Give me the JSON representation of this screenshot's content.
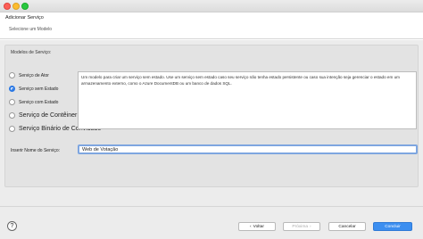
{
  "window": {
    "title": "Adicionar Serviço",
    "subtitle": "Selecione um Modelo"
  },
  "models": {
    "label": "Modelos de Serviço:",
    "options": [
      {
        "label": "Serviço de Ator",
        "selected": false
      },
      {
        "label": "Serviço sem Estado",
        "selected": true
      },
      {
        "label": "Serviço com Estado",
        "selected": false
      },
      {
        "label": "Serviço de Contêiner",
        "selected": false
      },
      {
        "label": "Serviço Binário de Convidado",
        "selected": false
      }
    ],
    "description": "Um modelo para criar um serviço sem estado. Use um serviço sem estado caso seu serviço não tenha estado persistente ou caso sua intenção seja gerenciar o estado em um armazenamento externo, como o Azure DocumentDB ou um banco de dados SQL."
  },
  "service_name": {
    "label": "Inserir Nome do Serviço:",
    "value": "Web de Votação"
  },
  "footer": {
    "help": "?",
    "back": "Voltar",
    "next": "Próxima",
    "cancel": "Cancelar",
    "finish": "Concluir"
  },
  "colors": {
    "accent": "#3b8ef0",
    "radio_selected": "#2a78e4",
    "input_focus": "#7ea6e0"
  }
}
